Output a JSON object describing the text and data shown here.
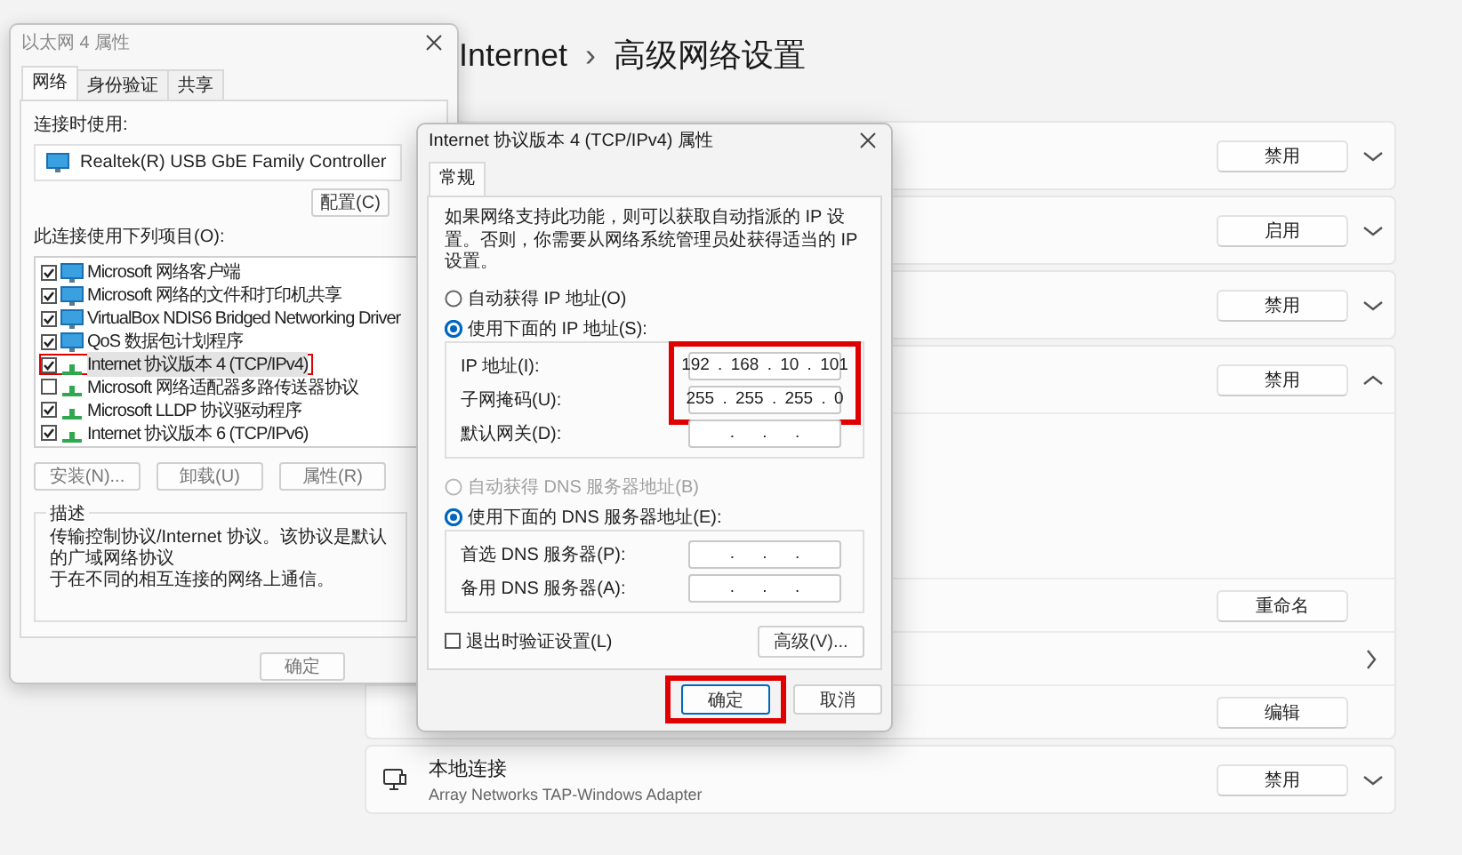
{
  "settings": {
    "breadcrumb": [
      {
        "text": "Internet"
      },
      {
        "text": "高级网络设置"
      }
    ],
    "separator": "›",
    "adapters": [
      {
        "button": "禁用",
        "expanded": false
      },
      {
        "button": "启用",
        "expanded": false
      },
      {
        "button": "禁用",
        "expanded": false
      },
      {
        "button": "禁用",
        "expanded": true,
        "rows": [
          {
            "kind": "button",
            "label": "重命名"
          },
          {
            "kind": "link"
          },
          {
            "kind": "button",
            "label": "编辑"
          }
        ]
      },
      {
        "name": "本地连接",
        "description": "Array Networks TAP-Windows Adapter",
        "button": "禁用",
        "expanded": false
      }
    ]
  },
  "ethernet_dialog": {
    "title": "以太网 4 属性",
    "tabs": [
      {
        "label": "网络",
        "selected": true
      },
      {
        "label": "身份验证",
        "selected": false
      },
      {
        "label": "共享",
        "selected": false
      }
    ],
    "connect_using_label": "连接时使用:",
    "adapter": "Realtek(R) USB GbE Family Controller",
    "configure_button": "配置(C)",
    "items_label": "此连接使用下列项目(O):",
    "items": [
      {
        "kind": "service",
        "label": "Microsoft 网络客户端",
        "checked": true,
        "selected": false,
        "highlighted": false
      },
      {
        "kind": "service",
        "label": "Microsoft 网络的文件和打印机共享",
        "checked": true,
        "selected": false,
        "highlighted": false
      },
      {
        "kind": "service",
        "label": "VirtualBox NDIS6 Bridged Networking Driver",
        "checked": true,
        "selected": false,
        "highlighted": false
      },
      {
        "kind": "service",
        "label": "QoS 数据包计划程序",
        "checked": true,
        "selected": false,
        "highlighted": false
      },
      {
        "kind": "protocol",
        "label": "Internet 协议版本 4 (TCP/IPv4)",
        "checked": true,
        "selected": true,
        "highlighted": true
      },
      {
        "kind": "protocol",
        "label": "Microsoft 网络适配器多路传送器协议",
        "checked": false,
        "selected": false,
        "highlighted": false
      },
      {
        "kind": "protocol",
        "label": "Microsoft LLDP 协议驱动程序",
        "checked": true,
        "selected": false,
        "highlighted": false
      },
      {
        "kind": "protocol",
        "label": "Internet 协议版本 6 (TCP/IPv6)",
        "checked": true,
        "selected": false,
        "highlighted": false
      }
    ],
    "item_buttons": [
      "安装(N)...",
      "卸载(U)",
      "属性(R)"
    ],
    "description_label": "描述",
    "description_lines": [
      "传输控制协议/Internet 协议。该协议是默认的广域网络协议",
      "于在不同的相互连接的网络上通信。"
    ],
    "ok_button": "确定"
  },
  "ipv4_dialog": {
    "title": "Internet 协议版本 4 (TCP/IPv4) 属性",
    "tabs": [
      {
        "label": "常规",
        "selected": true
      }
    ],
    "intro": "如果网络支持此功能，则可以获取自动指派的 IP 设置。否则，你需要从网络系统管理员处获得适当的 IP 设置。",
    "ip_options": [
      {
        "label": "自动获得 IP 地址(O)",
        "selected": false,
        "disabled": false
      },
      {
        "label": "使用下面的 IP 地址(S):",
        "selected": true,
        "disabled": false
      }
    ],
    "ip_fields": [
      {
        "label": "IP 地址(I):",
        "value": "192 . 168 . 10 . 101",
        "highlighted": true
      },
      {
        "label": "子网掩码(U):",
        "value": "255 . 255 . 255 . 0",
        "highlighted": true
      },
      {
        "label": "默认网关(D):",
        "value": ". . ."
      }
    ],
    "dns_options": [
      {
        "label": "自动获得 DNS 服务器地址(B)",
        "selected": false,
        "disabled": true
      },
      {
        "label": "使用下面的 DNS 服务器地址(E):",
        "selected": true,
        "disabled": false
      }
    ],
    "dns_fields": [
      {
        "label": "首选 DNS 服务器(P):",
        "value": ". . ."
      },
      {
        "label": "备用 DNS 服务器(A):",
        "value": ". . ."
      }
    ],
    "validate": {
      "label": "退出时验证设置(L)",
      "checked": false
    },
    "advanced_button": "高级(V)...",
    "buttons": [
      {
        "label": "确定",
        "default": true,
        "highlighted": true
      },
      {
        "label": "取消",
        "default": false
      }
    ]
  }
}
